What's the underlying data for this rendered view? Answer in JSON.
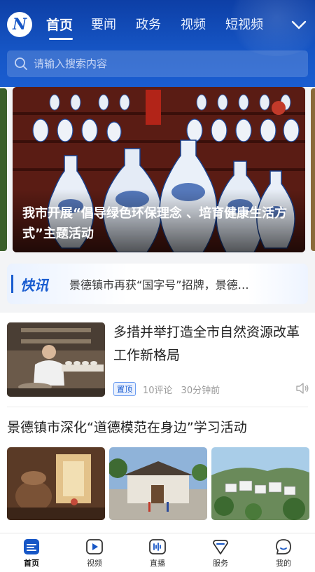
{
  "header": {
    "logo_text": "N",
    "tabs": [
      {
        "label": "首页",
        "active": true
      },
      {
        "label": "要闻",
        "active": false
      },
      {
        "label": "政务",
        "active": false
      },
      {
        "label": "视频",
        "active": false
      },
      {
        "label": "短视频",
        "active": false
      }
    ],
    "more_icon": "chevron-down-icon"
  },
  "search": {
    "placeholder": "请输入搜索内容",
    "icon": "search-icon"
  },
  "banner": {
    "caption": "我市开展“倡导绿色环保理念 、培育健康生活方式”主题活动"
  },
  "flash": {
    "label": "快讯",
    "text": "景德镇市再获“国字号”招牌，景德…"
  },
  "news": [
    {
      "title": "多措并举打造全市自然资源改革工作新格局",
      "badge": "置顶",
      "comments": "10评论",
      "time": "30分钟前",
      "speaker_icon": "speaker-icon"
    },
    {
      "title": "景德镇市深化“道德模范在身边”学习活动"
    }
  ],
  "bottom_nav": [
    {
      "label": "首页",
      "icon": "home-icon",
      "active": true
    },
    {
      "label": "视频",
      "icon": "video-play-icon",
      "active": false
    },
    {
      "label": "直播",
      "icon": "live-icon",
      "active": false
    },
    {
      "label": "服务",
      "icon": "service-icon",
      "active": false
    },
    {
      "label": "我的",
      "icon": "profile-icon",
      "active": false
    }
  ],
  "colors": {
    "brand_blue": "#1656c6",
    "header_top": "#0d3fa6",
    "accent_text": "#1a5dd0"
  }
}
